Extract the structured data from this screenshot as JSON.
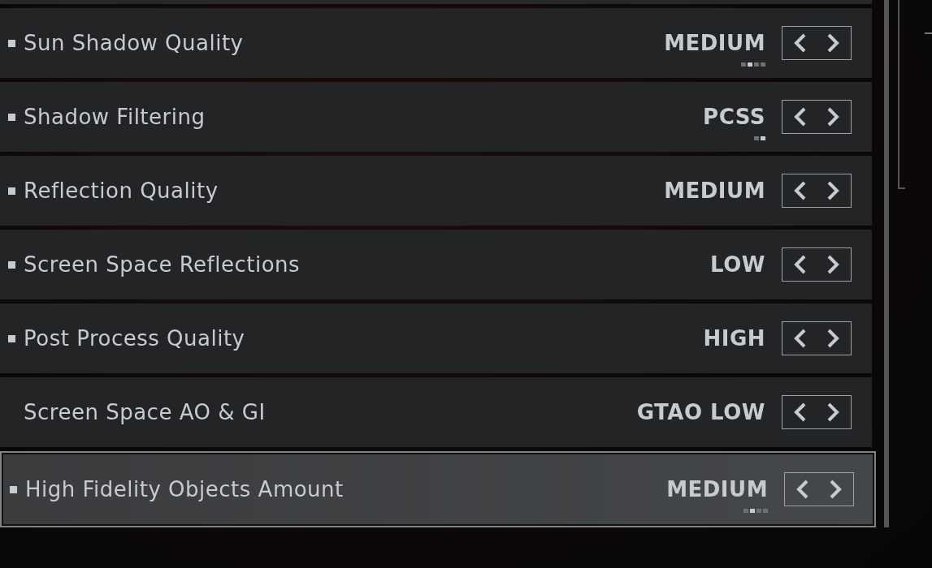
{
  "settings": [
    {
      "label": "Sun Shadow Quality",
      "modified": true,
      "selected": false,
      "value": "MEDIUM",
      "dots": [
        {
          "selected": false
        },
        {
          "selected": true
        },
        {
          "selected": false
        },
        {
          "selected": false
        }
      ]
    },
    {
      "label": "Shadow Filtering",
      "modified": true,
      "selected": false,
      "value": "PCSS",
      "dots": [
        {
          "selected": false
        },
        {
          "selected": true
        }
      ]
    },
    {
      "label": "Reflection Quality",
      "modified": true,
      "selected": false,
      "value": "MEDIUM"
    },
    {
      "label": "Screen Space Reflections",
      "modified": true,
      "selected": false,
      "value": "LOW"
    },
    {
      "label": "Post Process Quality",
      "modified": true,
      "selected": false,
      "value": "HIGH"
    },
    {
      "label": "Screen Space AO & GI",
      "modified": false,
      "selected": false,
      "value": "GTAO LOW"
    },
    {
      "label": "High Fidelity Objects Amount",
      "modified": true,
      "selected": true,
      "value": "MEDIUM",
      "dots": [
        {
          "selected": false
        },
        {
          "selected": true
        },
        {
          "selected": false
        },
        {
          "selected": false
        }
      ]
    }
  ]
}
